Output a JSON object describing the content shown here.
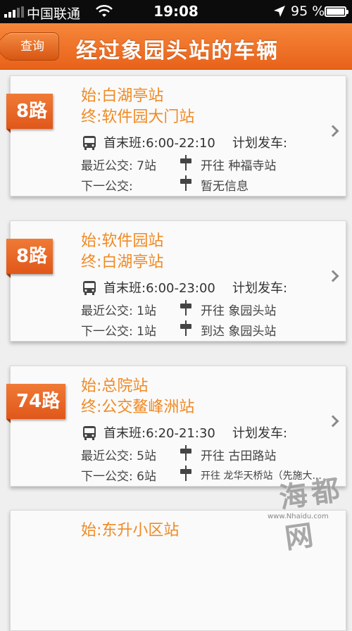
{
  "status_bar": {
    "carrier": "中国联通",
    "time": "19:08",
    "battery": "95 %"
  },
  "nav": {
    "back_label": "查询",
    "title": "经过象园头站的车辆"
  },
  "cards": [
    {
      "route": "8路",
      "start": "始:白湖亭站",
      "end": "终:软件园大门站",
      "first_last": "首末班:6:00-22:10",
      "plan": "计划发车:",
      "recent_label": "最近公交: 7站",
      "recent_dir": "开往 种福寺站",
      "next_label": "下一公交:",
      "next_dir": "暂无信息"
    },
    {
      "route": "8路",
      "start": "始:软件园站",
      "end": "终:白湖亭站",
      "first_last": "首末班:6:00-23:00",
      "plan": "计划发车:",
      "recent_label": "最近公交: 1站",
      "recent_dir": "开往 象园头站",
      "next_label": "下一公交: 1站",
      "next_dir": "到达 象园头站"
    },
    {
      "route": "74路",
      "start": "始:总院站",
      "end": "终:公交鳌峰洲站",
      "first_last": "首末班:6:20-21:30",
      "plan": "计划发车:",
      "recent_label": "最近公交: 5站",
      "recent_dir": "开往 古田路站",
      "next_label": "下一公交: 6站",
      "next_dir": "开往 龙华天桥站（先施大..."
    },
    {
      "start": "始:东升小区站"
    }
  ],
  "watermark": {
    "text": "海都网",
    "url": "www.Nhaidu.com"
  }
}
